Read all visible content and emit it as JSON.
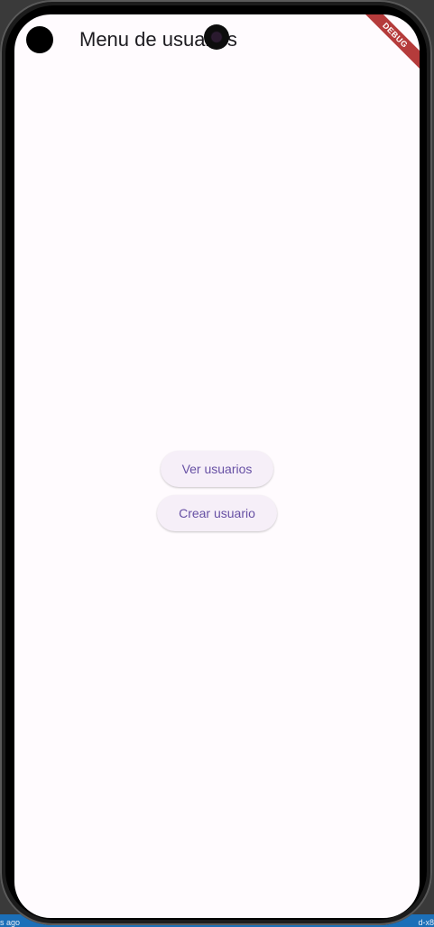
{
  "app": {
    "title": "Menu de usuarios",
    "debug_banner": "DEBUG"
  },
  "menu": {
    "view_users_label": "Ver usuarios",
    "create_user_label": "Crear usuario"
  },
  "host_strip": {
    "left_text": "s ago",
    "right_text": "d-x8"
  },
  "colors": {
    "background": "#fffbfe",
    "button_bg": "#f6eff8",
    "button_text": "#6750a4",
    "debug_ribbon": "#b53b3b"
  }
}
